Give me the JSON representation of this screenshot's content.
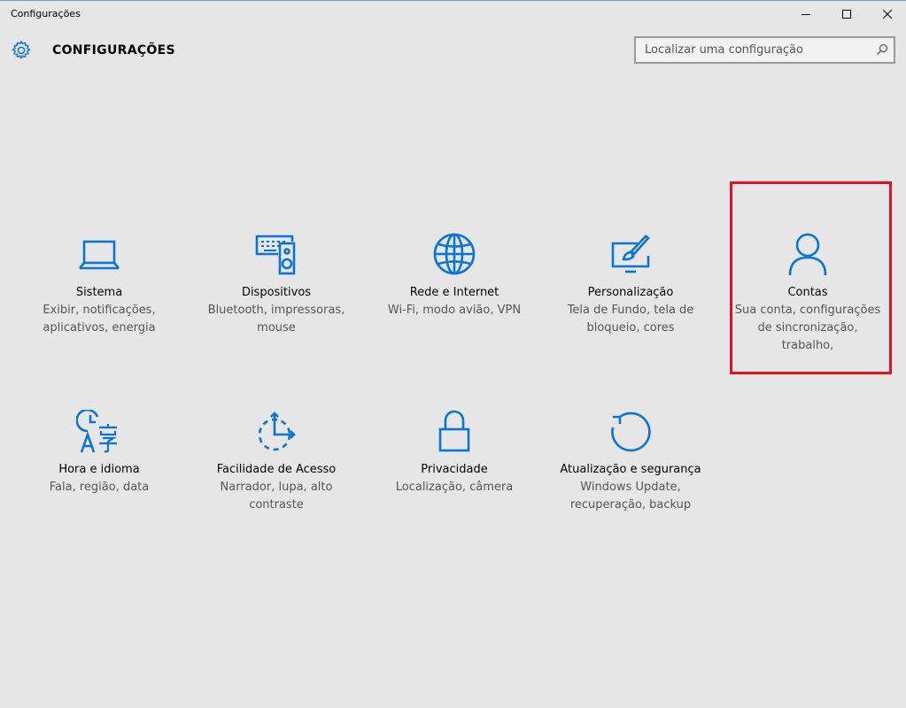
{
  "window": {
    "title": "Configurações"
  },
  "header": {
    "app_title": "CONFIGURAÇÕES",
    "search_placeholder": "Localizar uma configuração"
  },
  "colors": {
    "accent": "#0a74d6",
    "highlight": "#e1121e",
    "background": "#e6e6e6"
  },
  "tiles": [
    {
      "title": "Sistema",
      "desc": "Exibir, notificações, aplicativos, energia",
      "icon": "laptop-icon"
    },
    {
      "title": "Dispositivos",
      "desc": "Bluetooth, impressoras, mouse",
      "icon": "devices-icon"
    },
    {
      "title": "Rede e Internet",
      "desc": "Wi-Fi, modo avião, VPN",
      "icon": "globe-icon"
    },
    {
      "title": "Personalização",
      "desc": "Tela de Fundo, tela de bloqueio, cores",
      "icon": "paint-brush-icon"
    },
    {
      "title": "Contas",
      "desc": "Sua conta, configurações de sincronização, trabalho,",
      "icon": "user-icon"
    },
    {
      "title": "Hora e idioma",
      "desc": "Fala, região, data",
      "icon": "time-language-icon"
    },
    {
      "title": "Facilidade de Acesso",
      "desc": "Narrador, lupa, alto contraste",
      "icon": "ease-of-access-icon"
    },
    {
      "title": "Privacidade",
      "desc": "Localização, câmera",
      "icon": "lock-icon"
    },
    {
      "title": "Atualização e segurança",
      "desc": "Windows Update, recuperação, backup",
      "icon": "update-icon"
    }
  ]
}
